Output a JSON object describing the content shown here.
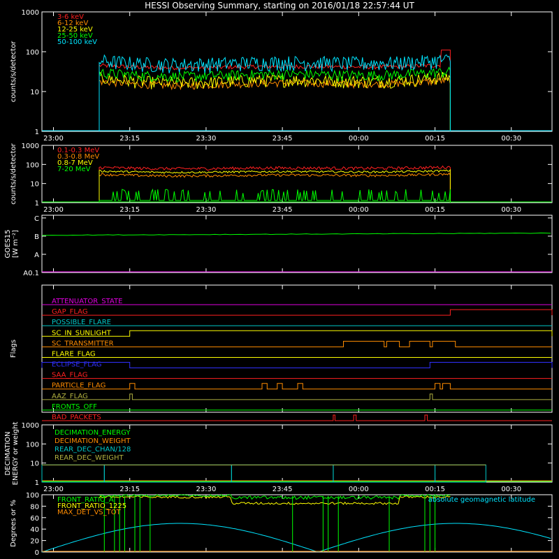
{
  "page": {
    "title": "HESSI Observing Summary, starting on 2016/01/18 22:57:44 UT"
  },
  "colors": {
    "background": "#000000",
    "axes": "#ffffff",
    "red": "#ff2020",
    "orange": "#ff8c00",
    "yellow": "#ffff00",
    "green": "#00ff00",
    "cyan": "#00e5ff",
    "magenta": "#e000e0",
    "blue": "#3030ff",
    "olive": "#b0b040",
    "teal": "#00c8c8"
  },
  "chart_data": [
    {
      "id": "panel1",
      "type": "line",
      "ylabel": "counts/s/detector",
      "yscale": "log",
      "ylim": [
        1,
        1000
      ],
      "yticks": [
        {
          "v": 1,
          "label": "1"
        },
        {
          "v": 10,
          "label": "10"
        },
        {
          "v": 100,
          "label": "100"
        },
        {
          "v": 1000,
          "label": "1000"
        }
      ],
      "xlim": [
        "22:57:44",
        "00:38:00"
      ],
      "xticks": [
        "23:00",
        "23:15",
        "23:30",
        "23:45",
        "00:00",
        "00:15",
        "00:30"
      ],
      "coverage": [
        "23:09",
        "00:18"
      ],
      "legend": [
        "3-6 keV",
        "6-12 keV",
        "12-25 keV",
        "25-50 keV",
        "50-100 keV"
      ],
      "series": [
        {
          "name": "3-6 keV",
          "color": "#ff2020",
          "base": 45,
          "amp": 0.25,
          "noise": 0.04,
          "spike": 110
        },
        {
          "name": "6-12 keV",
          "color": "#ff8c00",
          "base": 18,
          "amp": 0.45,
          "noise": 0.07
        },
        {
          "name": "12-25 keV",
          "color": "#ffff00",
          "base": 22,
          "amp": 0.5,
          "noise": 0.12
        },
        {
          "name": "25-50 keV",
          "color": "#00ff00",
          "base": 30,
          "amp": 0.4,
          "noise": 0.1
        },
        {
          "name": "50-100 keV",
          "color": "#00e5ff",
          "base": 60,
          "amp": 0.4,
          "noise": 0.14
        }
      ]
    },
    {
      "id": "panel2",
      "type": "line",
      "ylabel": "counts/s/detector",
      "yscale": "log",
      "ylim": [
        1,
        1000
      ],
      "yticks": [
        {
          "v": 1,
          "label": "1"
        },
        {
          "v": 10,
          "label": "10"
        },
        {
          "v": 100,
          "label": "100"
        },
        {
          "v": 1000,
          "label": "1000"
        }
      ],
      "xlim": [
        "22:57:44",
        "00:38:00"
      ],
      "xticks": [
        "23:00",
        "23:15",
        "23:30",
        "23:45",
        "00:00",
        "00:15",
        "00:30"
      ],
      "coverage": [
        "23:09",
        "00:18"
      ],
      "legend": [
        "0.1-0.3 MeV",
        "0.3-0.8 MeV",
        "0.8-7 MeV",
        "7-20 MeV"
      ],
      "series": [
        {
          "name": "0.1-0.3 MeV",
          "color": "#ff2020",
          "base": 70,
          "amp": 0.3,
          "noise": 0.06
        },
        {
          "name": "0.3-0.8 MeV",
          "color": "#ff8c00",
          "base": 30,
          "amp": 0.35,
          "noise": 0.05
        },
        {
          "name": "0.8-7 MeV",
          "color": "#ffff00",
          "base": 45,
          "amp": 0.3,
          "noise": 0.04
        },
        {
          "name": "7-20 MeV",
          "color": "#00ff00",
          "base": 1.5,
          "amp": 0.0,
          "noise": 0.0
        }
      ]
    },
    {
      "id": "panel3",
      "type": "line",
      "ylabel": "GOES15 [W m^-2]",
      "ylabel_lines": [
        "GOES15",
        "[W m⁻²]"
      ],
      "yticks": [
        {
          "v": 1,
          "label": "A0.1"
        },
        {
          "v": 2,
          "label": "A"
        },
        {
          "v": 3,
          "label": "B"
        },
        {
          "v": 4,
          "label": "C"
        }
      ],
      "ylim": [
        1,
        4.15
      ],
      "xlim": [
        "22:57:44",
        "00:38:00"
      ],
      "series": [
        {
          "name": "GOES",
          "color": "#00ff00",
          "level": 3.05
        }
      ]
    },
    {
      "id": "flags",
      "type": "line",
      "ylabel": "Flags",
      "xlim": [
        "22:57:44",
        "00:38:00"
      ],
      "flags": [
        {
          "label": "ATTENUATOR_STATE",
          "color": "#e000e0",
          "segments": []
        },
        {
          "label": "GAP_FLAG",
          "color": "#ff2020",
          "segments": [
            [
              "00:18",
              "00:38"
            ]
          ]
        },
        {
          "label": "POSSIBLE_FLARE",
          "color": "#00c8c8",
          "segments": []
        },
        {
          "label": "SC_IN_SUNLIGHT",
          "color": "#ffff00",
          "segments": [
            [
              "23:15",
              "00:38"
            ]
          ]
        },
        {
          "label": "SC_TRANSMITTER",
          "color": "#ff8c00",
          "segments": [
            [
              "23:57",
              "00:05"
            ],
            [
              "00:05:30",
              "00:08"
            ],
            [
              "00:10",
              "00:14"
            ],
            [
              "00:14:30",
              "00:19"
            ]
          ]
        },
        {
          "label": "FLARE_FLAG",
          "color": "#ffff00",
          "segments": []
        },
        {
          "label": "ECLIPSE_FLAG",
          "color": "#3030ff",
          "segments": [
            [
              "22:57:44",
              "23:15"
            ],
            [
              "00:14",
              "00:38"
            ]
          ]
        },
        {
          "label": "SAA_FLAG",
          "color": "#ff2020",
          "segments": []
        },
        {
          "label": "PARTICLE_FLAG",
          "color": "#ff8c00",
          "segments": [
            [
              "23:15",
              "23:16"
            ],
            [
              "23:41",
              "23:42"
            ],
            [
              "23:44",
              "23:45"
            ],
            [
              "23:48",
              "23:49"
            ],
            [
              "00:15",
              "00:16"
            ],
            [
              "00:16:30",
              "00:18"
            ]
          ]
        },
        {
          "label": "AAZ_FLAG",
          "color": "#b0b040",
          "segments": [
            [
              "23:15",
              "23:15:30"
            ],
            [
              "00:14",
              "00:14:30"
            ]
          ]
        },
        {
          "label": "FRONTS_OFF",
          "color": "#00ff00",
          "segments": []
        },
        {
          "label": "BAD_PACKETS",
          "color": "#ff2020",
          "segments": [
            [
              "23:55",
              "23:55:20"
            ],
            [
              "23:59",
              "23:59:30"
            ],
            [
              "00:13",
              "00:13:30"
            ]
          ]
        }
      ]
    },
    {
      "id": "decimation",
      "type": "line",
      "ylabel": "DECIMATION ENERGY or weight",
      "ylabel_lines": [
        "DECIMATION",
        "ENERGY or weight"
      ],
      "yscale": "log",
      "ylim": [
        1,
        1000
      ],
      "yticks": [
        {
          "v": 1,
          "label": "1"
        },
        {
          "v": 10,
          "label": "10"
        },
        {
          "v": 100,
          "label": "100"
        },
        {
          "v": 1000,
          "label": "1000"
        }
      ],
      "xlim": [
        "22:57:44",
        "00:38:00"
      ],
      "xticks": [
        "23:00",
        "23:15",
        "23:30",
        "23:45",
        "00:00",
        "00:15",
        "00:30"
      ],
      "legend": [
        "DECIMATION_ENERGY",
        "DECIMATION_WEIGHT",
        "REAR_DEC_CHAN/128",
        "REAR_DEC_WEIGHT"
      ],
      "series": [
        {
          "name": "DECIMATION_ENERGY",
          "color": "#00ff00",
          "level": 1.0
        },
        {
          "name": "DECIMATION_WEIGHT",
          "color": "#ff8c00",
          "level": 1.0
        },
        {
          "name": "REAR_DEC_CHAN/128",
          "color": "#00c8c8",
          "segments": [
            [
              "22:57:44",
              "23:10",
              8
            ],
            [
              "23:10",
              "23:35",
              8
            ],
            [
              "23:35",
              "23:55",
              8
            ],
            [
              "23:55",
              "00:15",
              8
            ],
            [
              "00:15",
              "00:25",
              8
            ]
          ]
        },
        {
          "name": "REAR_DEC_WEIGHT",
          "color": "#b0b040",
          "level": 8.0
        }
      ]
    },
    {
      "id": "panel6",
      "type": "line",
      "ylabel": "Degrees or %",
      "ylim": [
        0,
        100
      ],
      "yticks": [
        {
          "v": 0,
          "label": "0"
        },
        {
          "v": 20,
          "label": "20"
        },
        {
          "v": 40,
          "label": "40"
        },
        {
          "v": 60,
          "label": "60"
        },
        {
          "v": 80,
          "label": "80"
        },
        {
          "v": 100,
          "label": "100"
        }
      ],
      "xlim": [
        "22:57:44",
        "00:38:00"
      ],
      "legend": [
        "FRONT_RATIO_A",
        "FRONT_RATIO_1225",
        "MAX_DET_VS_TOT"
      ],
      "annotation": "absolute geomagnetic latitude",
      "series": [
        {
          "name": "FRONT_RATIO_A",
          "color": "#00ff00"
        },
        {
          "name": "FRONT_RATIO_1225",
          "color": "#ffff00"
        },
        {
          "name": "MAX_DET_VS_TOT",
          "color": "#ff8c00"
        },
        {
          "name": "absolute geomagnetic latitude",
          "color": "#00e5ff",
          "peak": 50
        }
      ]
    }
  ]
}
